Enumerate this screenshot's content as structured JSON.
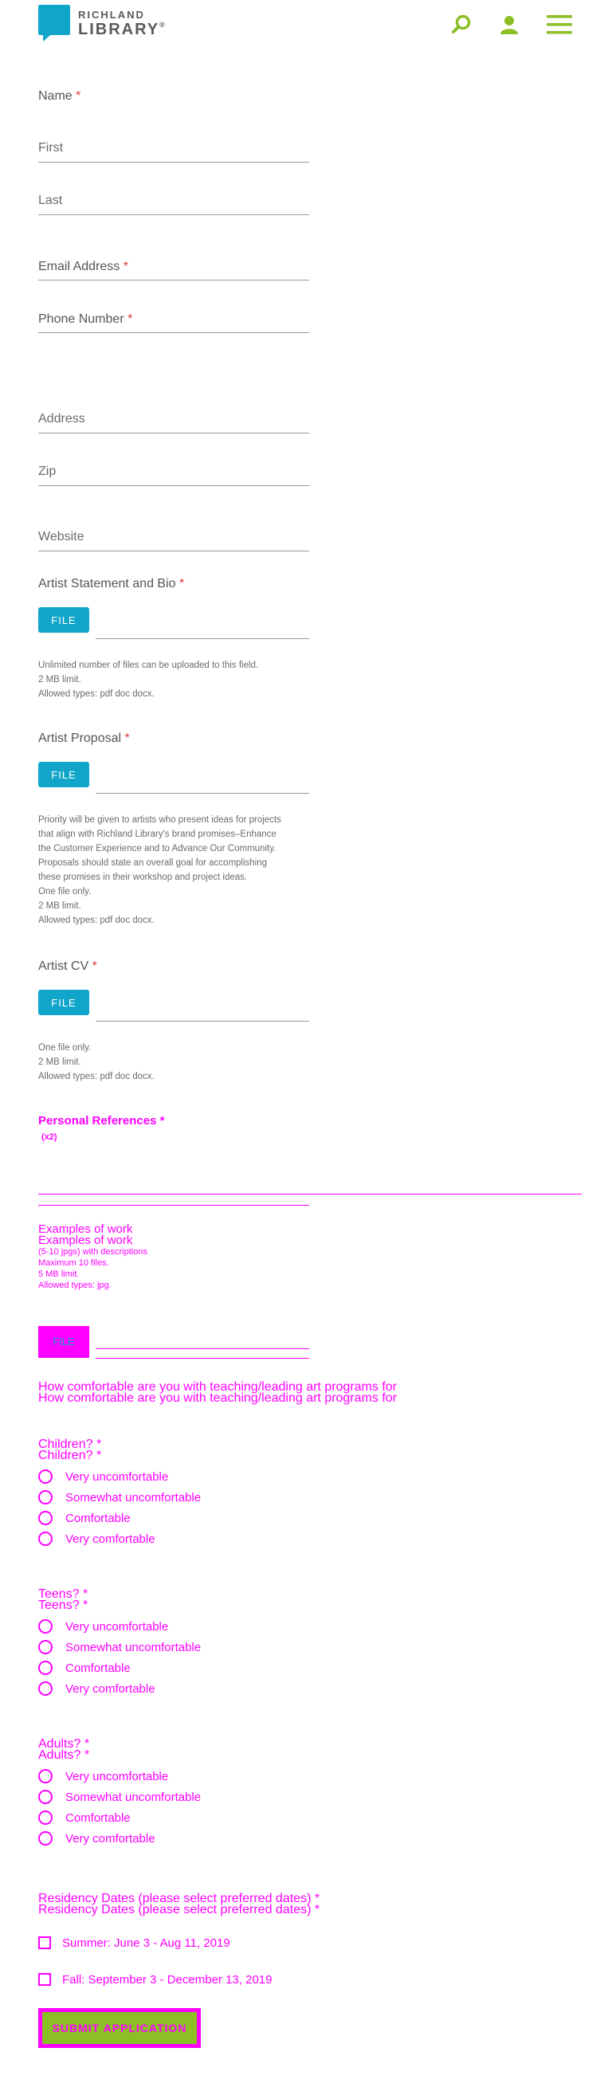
{
  "header": {
    "logo_line1": "RICHLAND",
    "logo_line2": "LIBRARY",
    "logo_mark": "®",
    "icons": [
      "search-icon",
      "user-icon",
      "menu-icon"
    ],
    "accent_color": "#8cbf26",
    "brand_color": "#11a6c9"
  },
  "form": {
    "name_label": "Name",
    "required_mark": "*",
    "first_placeholder": "First",
    "last_placeholder": "Last",
    "email_label": "Email Address",
    "phone_label": "Phone Number",
    "address_placeholder": "Address",
    "zip_placeholder": "Zip",
    "website_placeholder": "Website",
    "file_button": "FILE",
    "statement": {
      "label": "Artist Statement and Bio",
      "hint": [
        "Unlimited number of files can be uploaded to this field.",
        "2 MB limit.",
        "Allowed types: pdf doc docx."
      ]
    },
    "proposal": {
      "label": "Artist Proposal",
      "hint": [
        "Priority will be given to artists who present ideas for projects",
        "that align with Richland Library's brand promises–Enhance",
        "the Customer Experience and to Advance Our Community.",
        "Proposals should state an overall goal for accomplishing",
        "these promises in their workshop and project ideas.",
        "One file only.",
        "2 MB limit.",
        "Allowed types: pdf doc docx."
      ]
    },
    "cv": {
      "label": "Artist CV",
      "hint": [
        "One file only.",
        "2 MB limit.",
        "Allowed types: pdf doc docx."
      ]
    },
    "references": {
      "label": "Personal References",
      "sub": "(x2)"
    },
    "examples": {
      "label": "Examples of work",
      "hint": [
        "(5-10 jpgs) with descriptions",
        "Maximum 10 files.",
        "5 MB limit.",
        "Allowed types: jpg."
      ]
    },
    "comfort_question": "How comfortable are you with teaching/leading art programs for",
    "groups": [
      {
        "label": "Children?"
      },
      {
        "label": "Teens?"
      },
      {
        "label": "Adults?"
      }
    ],
    "comfort_options": [
      "Very uncomfortable",
      "Somewhat uncomfortable",
      "Comfortable",
      "Very comfortable"
    ],
    "residency": {
      "label": "Residency Dates (please select preferred dates)",
      "options": [
        "Summer: June 3 - Aug 11, 2019",
        "Fall: September 3 - December 13, 2019"
      ]
    },
    "submit_label": "SUBMIT APPLICATION"
  }
}
